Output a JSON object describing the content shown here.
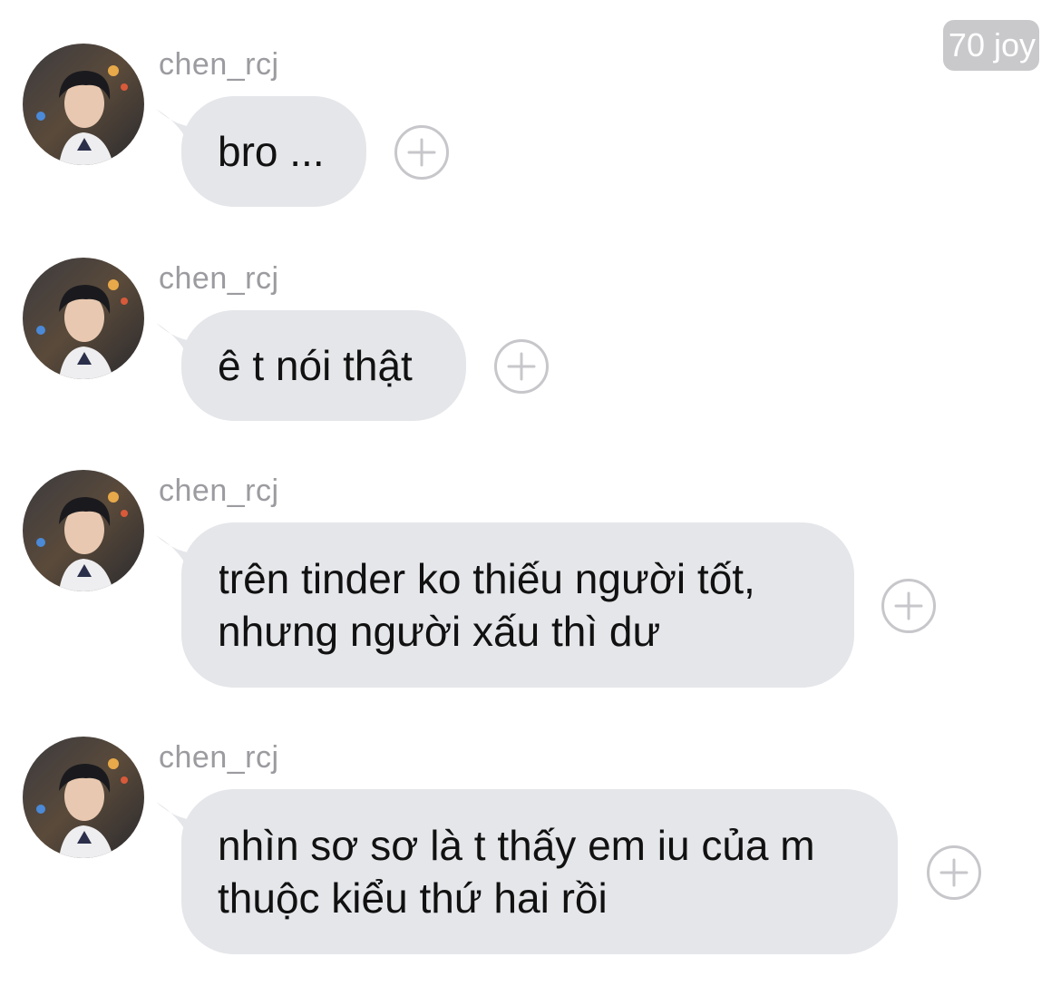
{
  "badge": {
    "text": "70 joy"
  },
  "messages": [
    {
      "username": "chen_rcj",
      "lines": [
        "bro ..."
      ]
    },
    {
      "username": "chen_rcj",
      "lines": [
        "ê t nói thật"
      ]
    },
    {
      "username": "chen_rcj",
      "lines": [
        "trên tinder ko thiếu người tốt,",
        "nhưng người xấu thì dư"
      ]
    },
    {
      "username": "chen_rcj",
      "lines": [
        "nhìn sơ sơ là t thấy em iu của m",
        "thuộc kiểu thứ hai rồi"
      ]
    }
  ],
  "icons": {
    "avatar": "profile-photo",
    "reaction": "add-reaction-plus-icon"
  },
  "colors": {
    "bubble": "#e5e6ea",
    "username": "#9b9ba0",
    "badge": "#c9c9cc",
    "plus": "#c7c7cb"
  }
}
